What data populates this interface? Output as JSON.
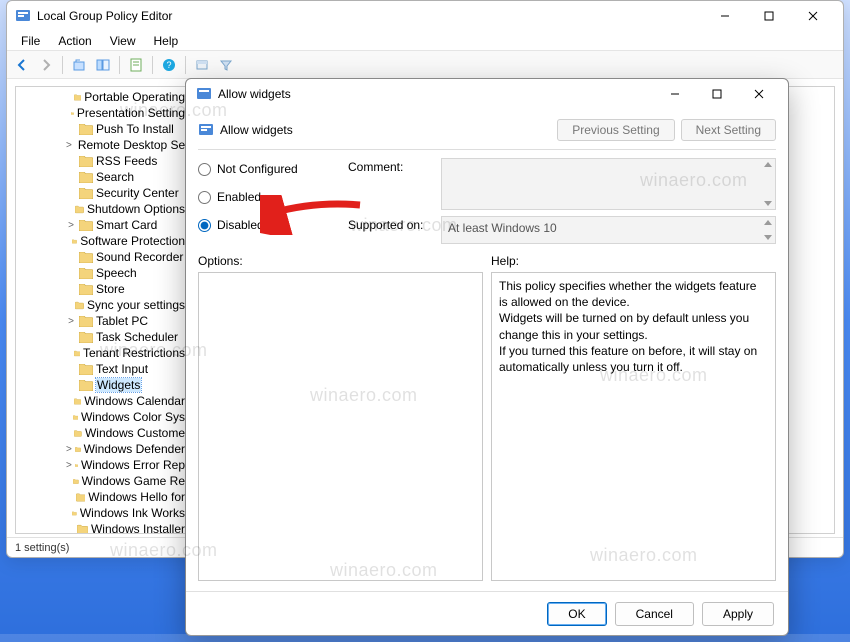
{
  "main": {
    "title": "Local Group Policy Editor",
    "menu": {
      "file": "File",
      "action": "Action",
      "view": "View",
      "help": "Help"
    },
    "status": "1 setting(s)",
    "tree": {
      "items": [
        {
          "label": "Portable Operating",
          "twisty": ""
        },
        {
          "label": "Presentation Setting",
          "twisty": ""
        },
        {
          "label": "Push To Install",
          "twisty": ""
        },
        {
          "label": "Remote Desktop Se",
          "twisty": ">"
        },
        {
          "label": "RSS Feeds",
          "twisty": ""
        },
        {
          "label": "Search",
          "twisty": ""
        },
        {
          "label": "Security Center",
          "twisty": ""
        },
        {
          "label": "Shutdown Options",
          "twisty": ""
        },
        {
          "label": "Smart Card",
          "twisty": ">"
        },
        {
          "label": "Software Protection",
          "twisty": ""
        },
        {
          "label": "Sound Recorder",
          "twisty": ""
        },
        {
          "label": "Speech",
          "twisty": ""
        },
        {
          "label": "Store",
          "twisty": ""
        },
        {
          "label": "Sync your settings",
          "twisty": ""
        },
        {
          "label": "Tablet PC",
          "twisty": ">"
        },
        {
          "label": "Task Scheduler",
          "twisty": ""
        },
        {
          "label": "Tenant Restrictions",
          "twisty": ""
        },
        {
          "label": "Text Input",
          "twisty": ""
        },
        {
          "label": "Widgets",
          "twisty": "",
          "selected": true
        },
        {
          "label": "Windows Calendar",
          "twisty": ""
        },
        {
          "label": "Windows Color Sys",
          "twisty": ""
        },
        {
          "label": "Windows Custome",
          "twisty": ""
        },
        {
          "label": "Windows Defender",
          "twisty": ">"
        },
        {
          "label": "Windows Error Rep",
          "twisty": ">"
        },
        {
          "label": "Windows Game Re",
          "twisty": ""
        },
        {
          "label": "Windows Hello for",
          "twisty": ""
        },
        {
          "label": "Windows Ink Works",
          "twisty": ""
        },
        {
          "label": "Windows Installer",
          "twisty": ""
        }
      ]
    }
  },
  "dialog": {
    "title": "Allow widgets",
    "header_label": "Allow widgets",
    "prev": "Previous Setting",
    "next": "Next Setting",
    "radios": {
      "not_configured": "Not Configured",
      "enabled": "Enabled",
      "disabled": "Disabled"
    },
    "selected_radio": "disabled",
    "comment_label": "Comment:",
    "supported_label": "Supported on:",
    "supported_value": "At least Windows 10",
    "options_label": "Options:",
    "help_label": "Help:",
    "help_text": "This policy specifies whether the widgets feature is allowed on the device.\nWidgets will be turned on by default unless you change this in your settings.\nIf you turned this feature on before, it will stay on automatically unless you turn it off.",
    "ok": "OK",
    "cancel": "Cancel",
    "apply": "Apply"
  },
  "watermark": "winaero.com"
}
